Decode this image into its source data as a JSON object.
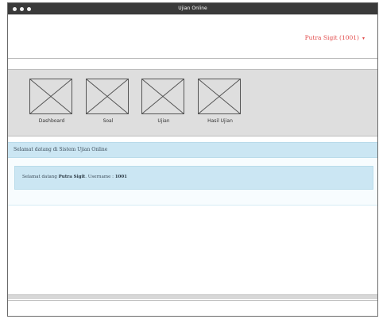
{
  "window": {
    "title": "Ujian Online"
  },
  "header": {
    "user_menu_label": "Putra Sigit (1001)",
    "user_menu_caret": "▾"
  },
  "nav": {
    "items": [
      {
        "label": "Dashboard",
        "icon": "image-placeholder-icon"
      },
      {
        "label": "Soal",
        "icon": "image-placeholder-icon"
      },
      {
        "label": "Ujian",
        "icon": "image-placeholder-icon"
      },
      {
        "label": "Hasil Ujian",
        "icon": "image-placeholder-icon"
      }
    ]
  },
  "breadcrumb": {
    "text": "Selamat datang di Sistem Ujian Online"
  },
  "alert": {
    "prefix": "Selamat datang ",
    "name": "Putra Sigit",
    "username_label": ". Username : ",
    "username": "1001"
  },
  "colors": {
    "accent_red": "#e24b4b",
    "info_blue": "#cbe6f3",
    "titlebar": "#3a3a3a",
    "nav_bg": "#dedede"
  }
}
